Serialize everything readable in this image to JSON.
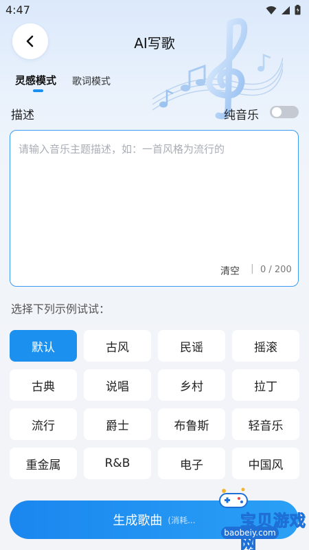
{
  "status_bar": {
    "time": "4:47"
  },
  "header": {
    "title": "AI写歌",
    "back_icon": "chevron-left-icon"
  },
  "tabs": [
    {
      "label": "灵感模式",
      "active": true
    },
    {
      "label": "歌词模式",
      "active": false
    }
  ],
  "description": {
    "label": "描述",
    "placeholder": "请输入音乐主题描述，如：一首风格为流行的",
    "clear_label": "清空",
    "separator": "|",
    "counter": "0 / 200"
  },
  "pure_music": {
    "label": "纯音乐",
    "enabled": false
  },
  "examples": {
    "label": "选择下列示例试试：",
    "items": [
      "默认",
      "古风",
      "民谣",
      "摇滚",
      "古典",
      "说唱",
      "乡村",
      "拉丁",
      "流行",
      "爵士",
      "布鲁斯",
      "轻音乐",
      "重金属",
      "R&B",
      "电子",
      "中国风"
    ],
    "selected": "默认"
  },
  "generate": {
    "label": "生成歌曲",
    "sub_label": "(消耗..."
  },
  "watermark": {
    "text": "宝贝游戏网",
    "url": "baobeiy.com"
  },
  "colors": {
    "accent": "#1b90ef",
    "toggle_off": "#c5cad2",
    "background": "#f2f4f8"
  }
}
